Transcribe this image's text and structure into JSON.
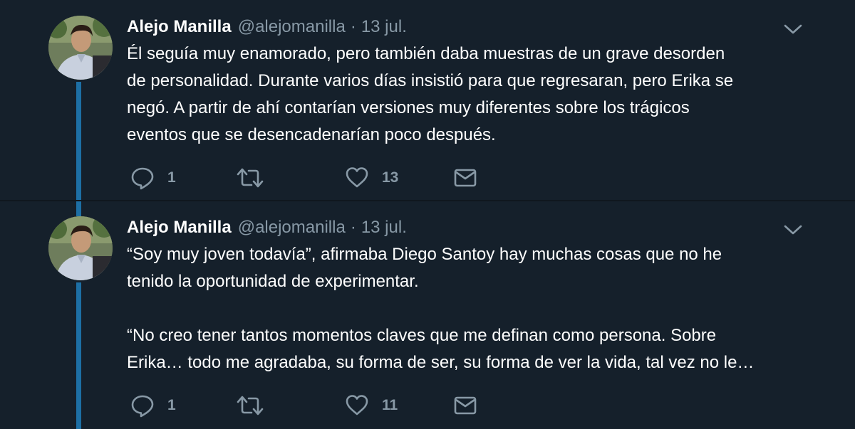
{
  "tweets": [
    {
      "author_name": "Alejo Manilla",
      "handle": "@alejomanilla",
      "separator": "·",
      "date": "13 jul.",
      "text": "Él seguía muy enamorado, pero también daba muestras de un grave desorden\nde personalidad. Durante varios días insistió para que regresaran, pero Erika se\nnegó. A partir de ahí contarían versiones muy diferentes sobre los trágicos\neventos que se desencadenarían poco después.",
      "reply_count": "1",
      "retweet_count": "",
      "like_count": "13",
      "icons": [
        "reply-icon",
        "retweet-icon",
        "like-icon",
        "message-icon",
        "chevron-down-icon"
      ]
    },
    {
      "author_name": "Alejo Manilla",
      "handle": "@alejomanilla",
      "separator": "·",
      "date": "13 jul.",
      "text": "“Soy muy joven todavía”, afirmaba Diego Santoy hay muchas cosas que no he\ntenido la oportunidad de experimentar.\n\n“No creo tener tantos momentos claves que me definan como persona. Sobre\nErika… todo me agradaba, su forma de ser, su forma de ver la vida, tal vez no le…",
      "reply_count": "1",
      "retweet_count": "",
      "like_count": "11",
      "icons": [
        "reply-icon",
        "retweet-icon",
        "like-icon",
        "message-icon",
        "chevron-down-icon"
      ]
    }
  ],
  "colors": {
    "background": "#15202b",
    "separator": "#10171e",
    "thread_line": "#1d6fa5",
    "text_primary": "#ffffff",
    "text_secondary": "#8899a6"
  }
}
